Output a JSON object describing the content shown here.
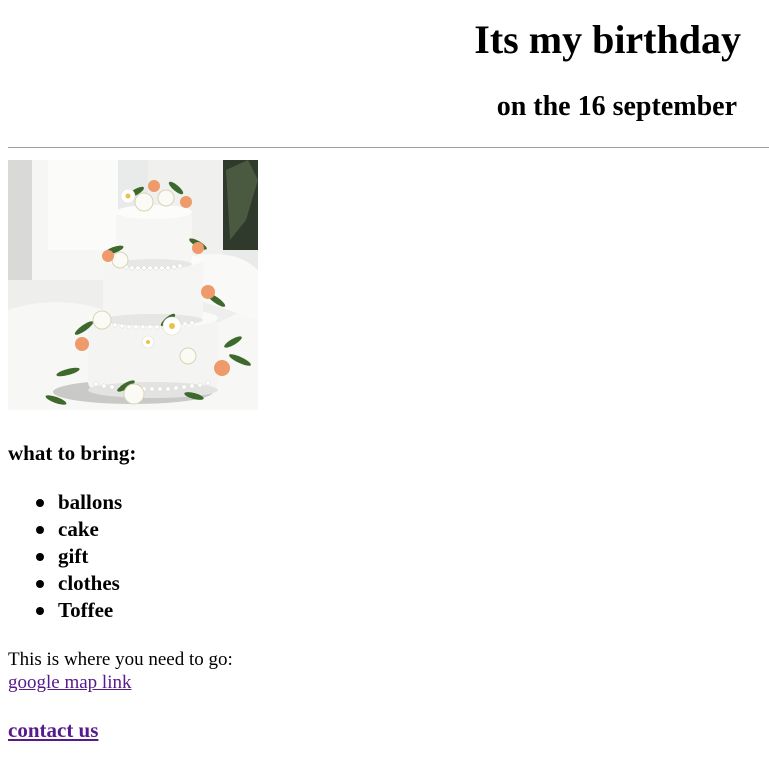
{
  "header": {
    "title": "Its my birthday",
    "subtitle": "on the 16 september"
  },
  "image": {
    "alt": "three-tier white wedding cake decorated with flowers"
  },
  "bring": {
    "heading": "what to bring:",
    "items": [
      "ballons",
      "cake",
      "gift",
      "clothes",
      "Toffee"
    ]
  },
  "directions": {
    "text": "This is where you need to go:",
    "link_label": "google map link"
  },
  "contact": {
    "link_label": "contact us"
  },
  "colors": {
    "visited_link": "#551a8b",
    "rule": "#a0a0a0",
    "cake_white": "#f4f4f2",
    "flower_peach": "#ee9a6a",
    "leaf_green": "#3d6a2c"
  }
}
